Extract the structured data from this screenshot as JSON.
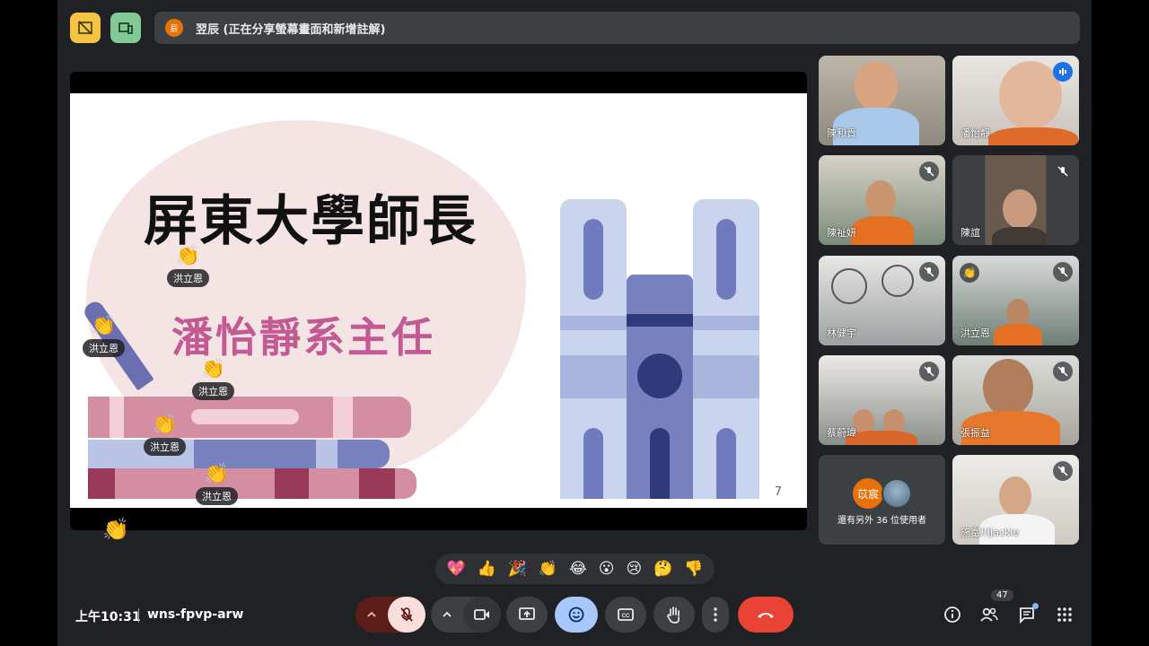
{
  "presenter_bar": {
    "avatar_initial": "辰",
    "text": "翌辰 (正在分享螢幕畫面和新增註解)"
  },
  "slide": {
    "title": "屏東大學師長",
    "subtitle": "潘怡靜系主任",
    "page": "7"
  },
  "slide_reactions": [
    {
      "emoji": "👏",
      "name": "洪立恩"
    },
    {
      "emoji": "👏",
      "name": "洪立恩"
    },
    {
      "emoji": "👏",
      "name": "洪立恩"
    },
    {
      "emoji": "👏",
      "name": "洪立恩"
    },
    {
      "emoji": "👏",
      "name": "洪立恩"
    }
  ],
  "floating_reaction": "👏",
  "participants": [
    {
      "name": "陳和貴"
    },
    {
      "name": "潘怡靜"
    },
    {
      "name": "陳祉妍"
    },
    {
      "name": "陳誼"
    },
    {
      "name": "林健宇"
    },
    {
      "name": "洪立恩"
    },
    {
      "name": "蔡蔚瑋"
    },
    {
      "name": "張振益"
    },
    {
      "name": "施富川Jackie"
    }
  ],
  "others_tile": {
    "avatar1": "苡宸",
    "text": "還有另外 36 位使用者"
  },
  "reaction_bar": [
    "💖",
    "👍",
    "🎉",
    "👏",
    "😂",
    "😮",
    "😢",
    "🤔",
    "👎"
  ],
  "bottom": {
    "time": "上午10:31",
    "meeting_code": "wns-fpvp-arw",
    "participant_count": "47"
  },
  "colors": {
    "background": "#202124",
    "end_call": "#ea4335",
    "mic_off": "#f9dedc",
    "emoji_active": "#a8c7fa"
  }
}
